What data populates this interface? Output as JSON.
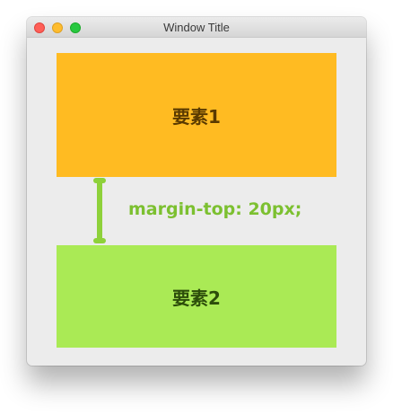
{
  "window": {
    "title": "Window Title"
  },
  "elements": {
    "first_label": "要素1",
    "second_label": "要素2"
  },
  "annotation": {
    "margin_label": "margin-top: 20px;"
  },
  "colors": {
    "element1_bg": "#ffbb22",
    "element2_bg": "#aaea55",
    "annotation": "#8ed13a"
  }
}
